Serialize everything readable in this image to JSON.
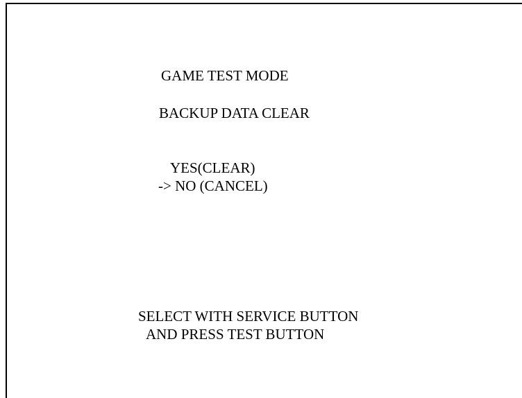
{
  "screen": {
    "title": "GAME TEST MODE",
    "subtitle": "BACKUP DATA CLEAR"
  },
  "menu": {
    "cursor": "->",
    "options": [
      {
        "label": "YES(CLEAR)",
        "selected": false
      },
      {
        "label": "NO (CANCEL)",
        "selected": true
      }
    ]
  },
  "instructions": {
    "line1": "SELECT WITH SERVICE BUTTON",
    "line2": "AND PRESS TEST BUTTON"
  },
  "colors": {
    "background": "#ffffff",
    "text": "#000000"
  }
}
